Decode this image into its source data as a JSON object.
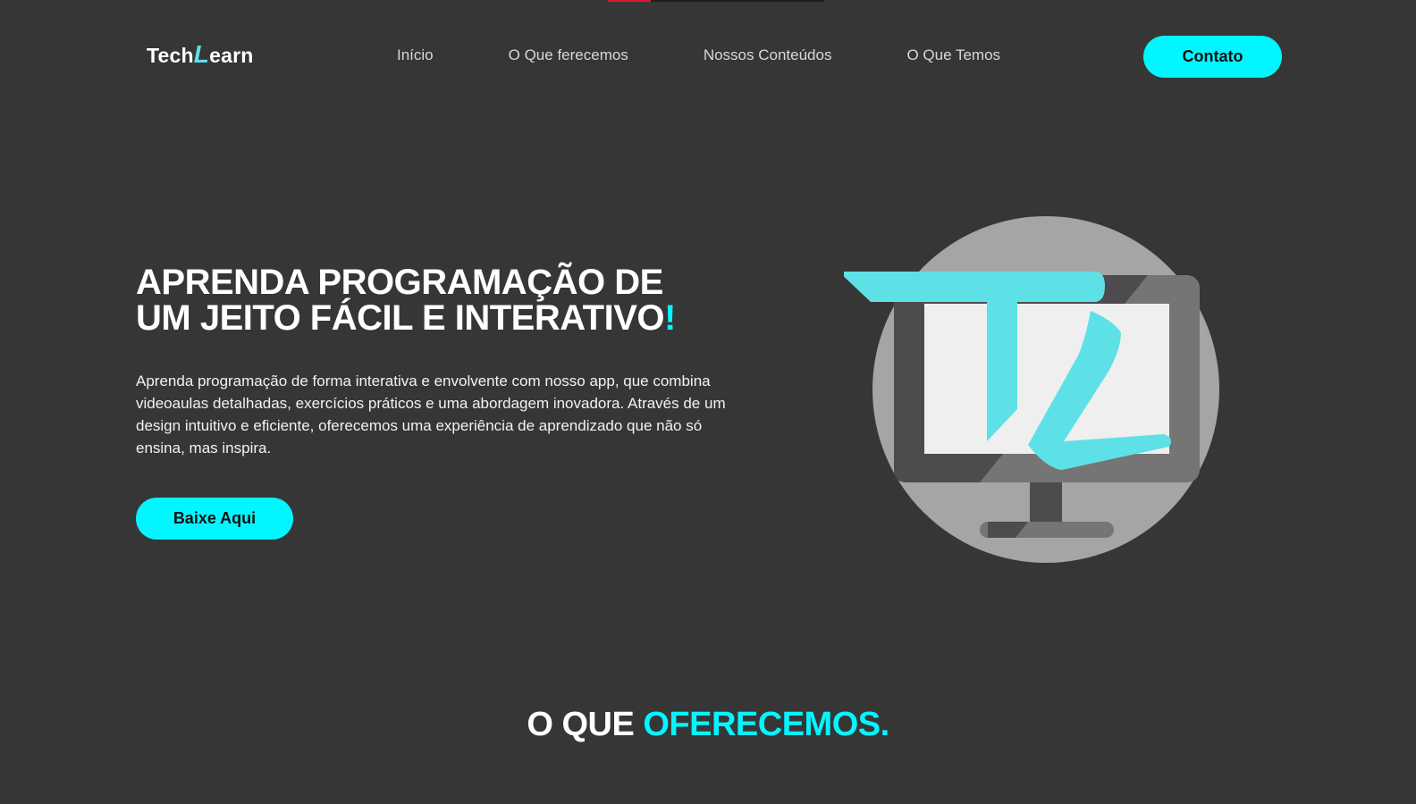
{
  "header": {
    "logo": {
      "prefix": "Tech",
      "accent_letter": "L",
      "suffix": "earn"
    },
    "nav": [
      {
        "label": "Início"
      },
      {
        "label": "O Que ferecemos"
      },
      {
        "label": "Nossos Conteúdos"
      },
      {
        "label": "O Que Temos"
      }
    ],
    "contact_label": "Contato"
  },
  "hero": {
    "title_line1": "APRENDA PROGRAMAÇÃO DE",
    "title_line2": "UM JEITO FÁCIL E INTERATIVO",
    "title_excl": "!",
    "description": "Aprenda programação de forma interativa e envolvente com nosso app, que combina videoaulas detalhadas, exercícios práticos e uma abordagem inovadora. Através de um design intuitivo e eficiente, oferecemos uma experiência de aprendizado que não só ensina, mas inspira.",
    "cta_label": "Baixe Aqui",
    "illustration_icon": "monitor-tl-logo-icon"
  },
  "section": {
    "title_plain": "O QUE ",
    "title_accent": "OFERECEMOS."
  },
  "colors": {
    "background": "#363636",
    "accent": "#00f7ff",
    "logo_accent": "#5fe0e8",
    "scroll_indicator": "#e0182d"
  },
  "scroll_progress": 0.2
}
